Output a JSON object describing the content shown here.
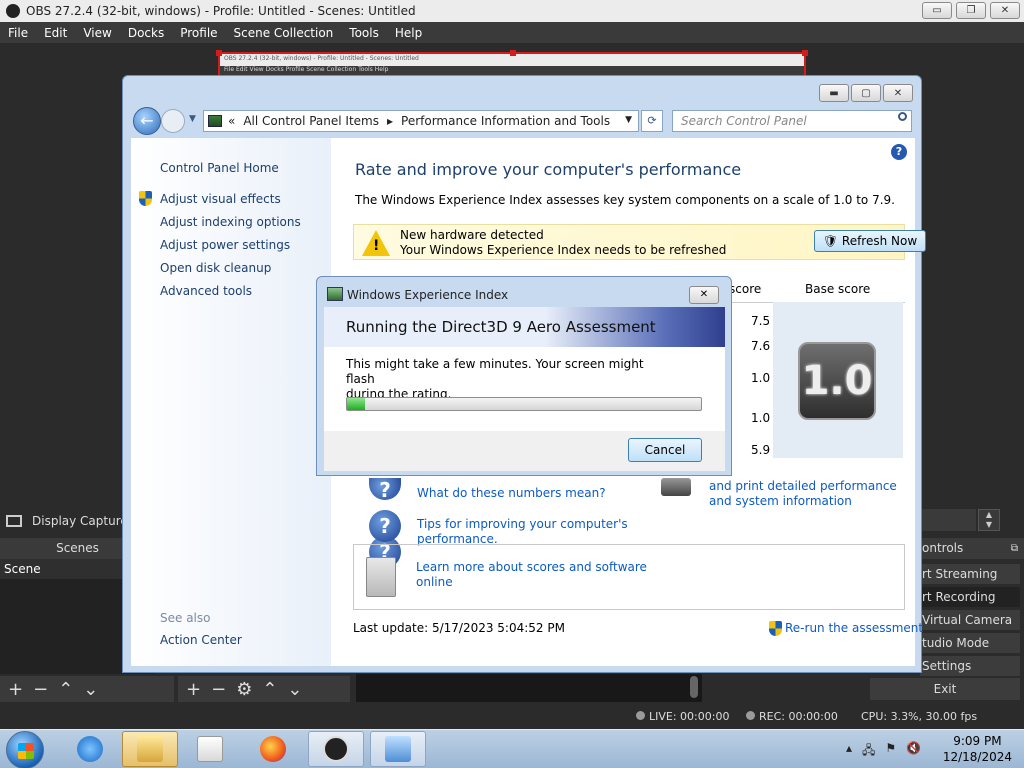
{
  "obs": {
    "title": "OBS 27.2.4 (32-bit, windows) - Profile: Untitled - Scenes: Untitled",
    "menu": [
      "File",
      "Edit",
      "View",
      "Docks",
      "Profile",
      "Scene Collection",
      "Tools",
      "Help"
    ],
    "window_buttons": [
      "▭",
      "❐",
      "✕"
    ],
    "mini_capture_title": "OBS 27.2.4 (32-bit, windows) - Profile: Untitled - Scenes: Untitled",
    "mini_capture_menu": "File   Edit   View   Docks   Profile   Scene Collection   Tools   Help",
    "source_label": "Display Capture",
    "scenes_header": "Scenes",
    "scene_item": "Scene",
    "controls_header": "ontrols",
    "controls": [
      "rt Streaming",
      "rt Recording",
      "Virtual Camera",
      "tudio Mode",
      "Settings"
    ],
    "exit_label": "Exit",
    "status": {
      "live": "LIVE: 00:00:00",
      "rec": "REC: 00:00:00",
      "cpu": "CPU: 3.3%, 30.00 fps"
    }
  },
  "control_panel": {
    "breadcrumb_root": "«",
    "breadcrumb": [
      "All Control Panel Items",
      "Performance Information and Tools"
    ],
    "search_placeholder": "Search Control Panel",
    "left_links": {
      "home": "Control Panel Home",
      "visual_effects": "Adjust visual effects",
      "indexing": "Adjust indexing options",
      "power": "Adjust power settings",
      "disk_cleanup": "Open disk cleanup",
      "advanced": "Advanced tools"
    },
    "see_also": "See also",
    "action_center": "Action Center",
    "page_title": "Rate and improve your computer's performance",
    "description": "The Windows Experience Index assesses key system components on a scale of 1.0 to 7.9.",
    "notice_line1": "New hardware detected",
    "notice_line2": "Your Windows Experience Index needs to be refreshed",
    "refresh_button": "Refresh Now",
    "subscore_header": "score",
    "base_score_header": "Base score",
    "subscores": [
      "7.5",
      "7.6",
      "1.0",
      "1.0",
      "5.9"
    ],
    "base_score": "1.0",
    "link_numbers": "What do these numbers mean?",
    "link_print_1": "and print detailed performance",
    "link_print_2": "and system information",
    "link_tips_1": "Tips for improving your computer's",
    "link_tips_2": "performance.",
    "link_learn_1": "Learn more about scores and software",
    "link_learn_2": "online",
    "last_update": "Last update: 5/17/2023 5:04:52 PM",
    "rerun": "Re-run the assessment"
  },
  "wei_dialog": {
    "title": "Windows Experience Index",
    "heading": "Running the Direct3D 9 Aero Assessment",
    "message_1": "This might take a few minutes. Your screen might flash",
    "message_2": "during the rating.",
    "progress_fraction": 0.05,
    "cancel": "Cancel"
  },
  "taskbar": {
    "time": "9:09 PM",
    "date": "12/18/2024"
  }
}
